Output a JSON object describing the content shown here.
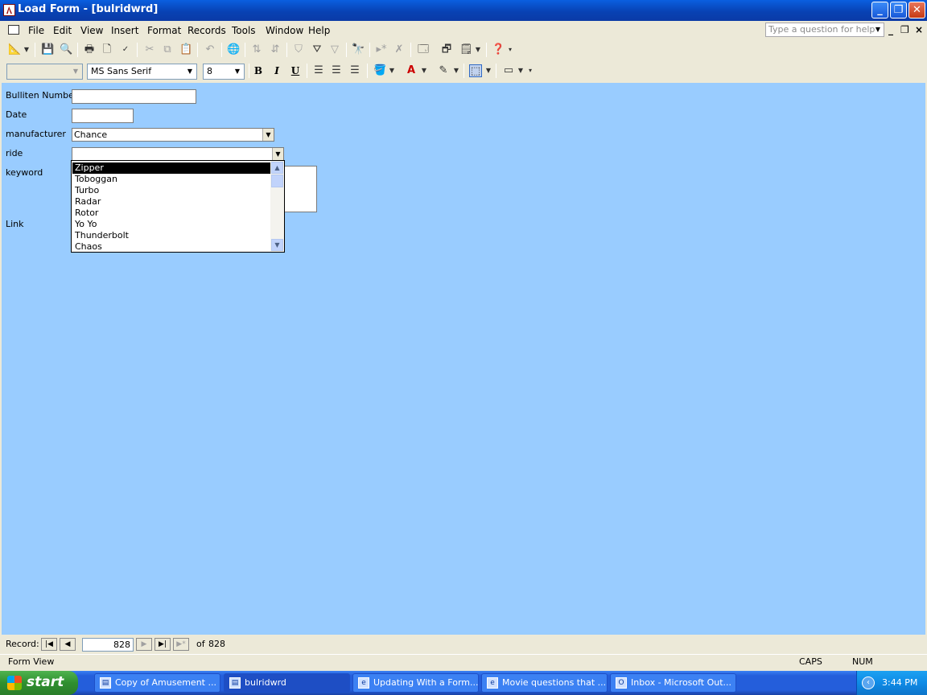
{
  "window": {
    "title": "Load Form - [bulridwrd]",
    "minimize": "_",
    "restore": "❐",
    "close": "✕"
  },
  "menu": {
    "items": [
      "File",
      "Edit",
      "View",
      "Insert",
      "Format",
      "Records",
      "Tools",
      "Window",
      "Help"
    ],
    "help_placeholder": "Type a question for help",
    "mdi_min": "_",
    "mdi_restore": "❐",
    "mdi_close": "×"
  },
  "formatting": {
    "object_combo": "",
    "font_name": "MS Sans Serif",
    "font_size": "8",
    "bold": "B",
    "italic": "I",
    "underline": "U"
  },
  "form": {
    "background_color": "#99ccff",
    "bulletin_label": "Bulliten Number",
    "bulletin_value": "",
    "date_label": "Date",
    "date_value": "",
    "manufacturer_label": "manufacturer",
    "manufacturer_value": "Chance",
    "ride_label": "ride",
    "ride_value": "",
    "keyword_label": "keyword",
    "link_label": "Link"
  },
  "ride_dropdown": {
    "options": [
      "Zipper",
      "Toboggan",
      "Turbo",
      "Radar",
      "Rotor",
      "Yo Yo",
      "Thunderbolt",
      "Chaos"
    ],
    "selected_index": 0
  },
  "navigator": {
    "label": "Record:",
    "current": "828",
    "of_label": "of",
    "total": "828"
  },
  "status": {
    "view": "Form View",
    "caps": "CAPS",
    "num": "NUM"
  },
  "taskbar": {
    "start": "start",
    "tasks": [
      {
        "label": "Copy of Amusement ...",
        "icon": "access-icon"
      },
      {
        "label": "bulridwrd",
        "icon": "form-icon"
      },
      {
        "label": "Updating With a Form...",
        "icon": "ie-icon"
      },
      {
        "label": "Movie questions that ...",
        "icon": "ie-icon"
      },
      {
        "label": "Inbox - Microsoft Out...",
        "icon": "outlook-icon"
      }
    ],
    "clock": "3:44 PM"
  }
}
